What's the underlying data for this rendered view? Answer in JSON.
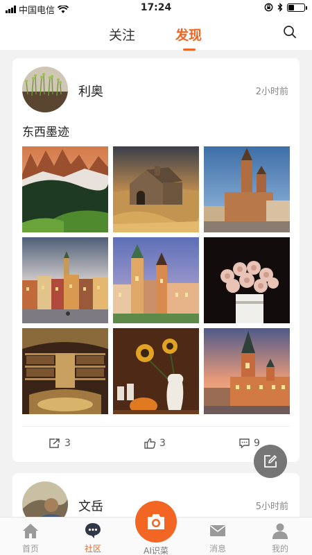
{
  "status_bar": {
    "carrier": "中国电信",
    "time": "17:24"
  },
  "header": {
    "tabs": [
      {
        "label": "关注"
      },
      {
        "label": "发现"
      }
    ],
    "active_tab": "发现",
    "accent_color": "#f26522"
  },
  "posts": [
    {
      "username": "利奥",
      "time_ago": "2小时前",
      "text": "东西墨迹",
      "photos": [
        "dolomites-mountains",
        "stone-church",
        "krakow-basilica",
        "warsaw-old-town",
        "wawel-castle",
        "rose-bouquet",
        "bookstore-interior",
        "sunflower-vase",
        "royal-castle-sunset"
      ],
      "shares": "3",
      "likes": "3",
      "comments": "9"
    },
    {
      "username": "文岳",
      "time_ago": "5小时前"
    }
  ],
  "tabbar": {
    "home": "首页",
    "community": "社区",
    "ai": "AI识菜",
    "messages": "消息",
    "me": "我的",
    "active": "社区"
  }
}
